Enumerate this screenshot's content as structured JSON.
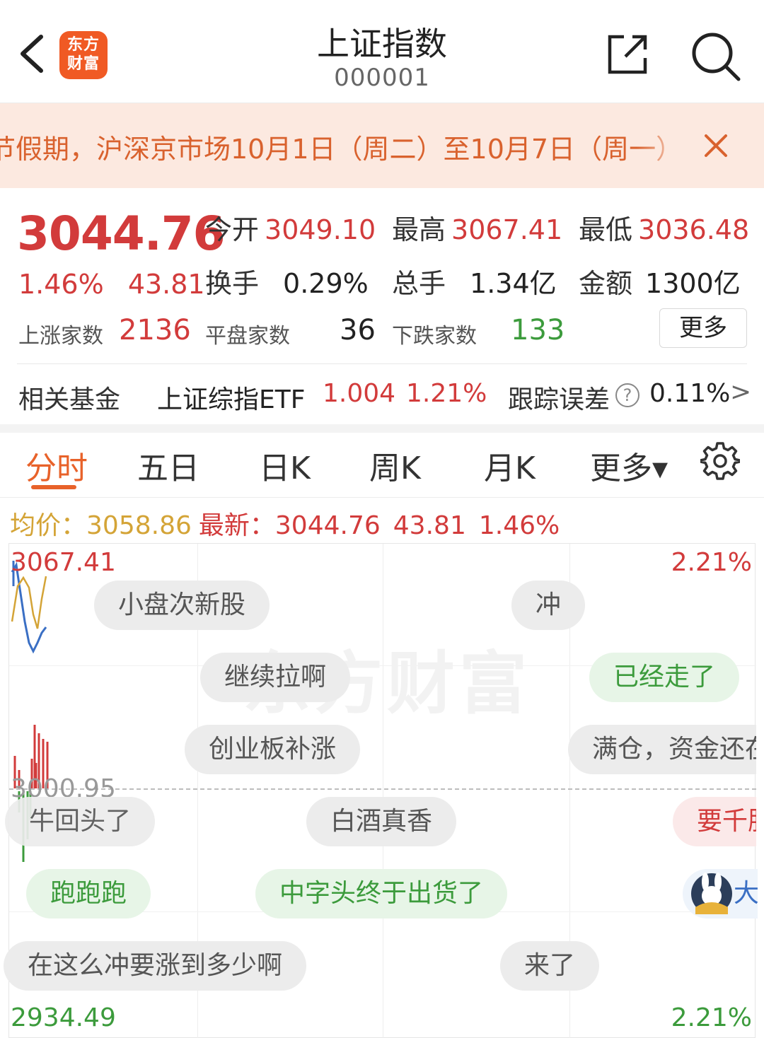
{
  "header": {
    "title": "上证指数",
    "code": "000001",
    "logo_line1": "东方",
    "logo_line2": "财富"
  },
  "notice": {
    "text": "节假期，沪深京市场10月1日（周二）至10月7日（周一）"
  },
  "quote": {
    "price": "3044.76",
    "change_pct": "1.46%",
    "change_amt": "43.81",
    "open_label": "今开",
    "open_value": "3049.10",
    "high_label": "最高",
    "high_value": "3067.41",
    "low_label": "最低",
    "low_value": "3036.48",
    "turnover_label": "换手",
    "turnover_value": "0.29%",
    "volume_label": "总手",
    "volume_value": "1.34亿",
    "amount_label": "金额",
    "amount_value": "1300亿",
    "up_label": "上涨家数",
    "up_value": "2136",
    "flat_label": "平盘家数",
    "flat_value": "36",
    "down_label": "下跌家数",
    "down_value": "133",
    "more_label": "更多"
  },
  "fund": {
    "label": "相关基金",
    "name": "上证综指ETF",
    "value": "1.004",
    "pct": "1.21%",
    "tracking_label": "跟踪误差",
    "tracking_value": "0.11%",
    "arrow": ">"
  },
  "tabs": [
    {
      "label": "分时",
      "active": true
    },
    {
      "label": "五日"
    },
    {
      "label": "日K"
    },
    {
      "label": "周K"
    },
    {
      "label": "月K"
    },
    {
      "label": "更多▾"
    }
  ],
  "avg_row": {
    "avg_label": "均价：",
    "avg_value": "3058.86",
    "latest_label": "最新：",
    "latest_price": "3044.76",
    "latest_change": "43.81",
    "latest_pct": "1.46%"
  },
  "chart": {
    "top_left": "3067.41",
    "top_right": "2.21%",
    "mid_left": "3000.95",
    "bottom_left": "2934.49",
    "bottom_right": "2.21%",
    "watermark": "东方财富"
  },
  "comments": [
    {
      "text": "小盘次新股",
      "style": "gray"
    },
    {
      "text": "冲",
      "style": "gray"
    },
    {
      "text": "继续拉啊",
      "style": "gray"
    },
    {
      "text": "已经走了",
      "style": "green"
    },
    {
      "text": "创业板补涨",
      "style": "gray"
    },
    {
      "text": "满仓，资金还在",
      "style": "gray"
    },
    {
      "text": "牛回头了",
      "style": "gray"
    },
    {
      "text": "白酒真香",
      "style": "gray"
    },
    {
      "text": "要千股",
      "style": "pink"
    },
    {
      "text": "跑跑跑",
      "style": "green"
    },
    {
      "text": "中字头终于出货了",
      "style": "green"
    },
    {
      "text": "大",
      "style": "gray"
    },
    {
      "text": "在这么冲要涨到多少啊",
      "style": "gray"
    },
    {
      "text": "来了",
      "style": "gray"
    }
  ],
  "colors": {
    "up": "#d23b3b",
    "down": "#3c9b3c",
    "accent": "#e8622a",
    "avg_line": "#d4a437"
  }
}
